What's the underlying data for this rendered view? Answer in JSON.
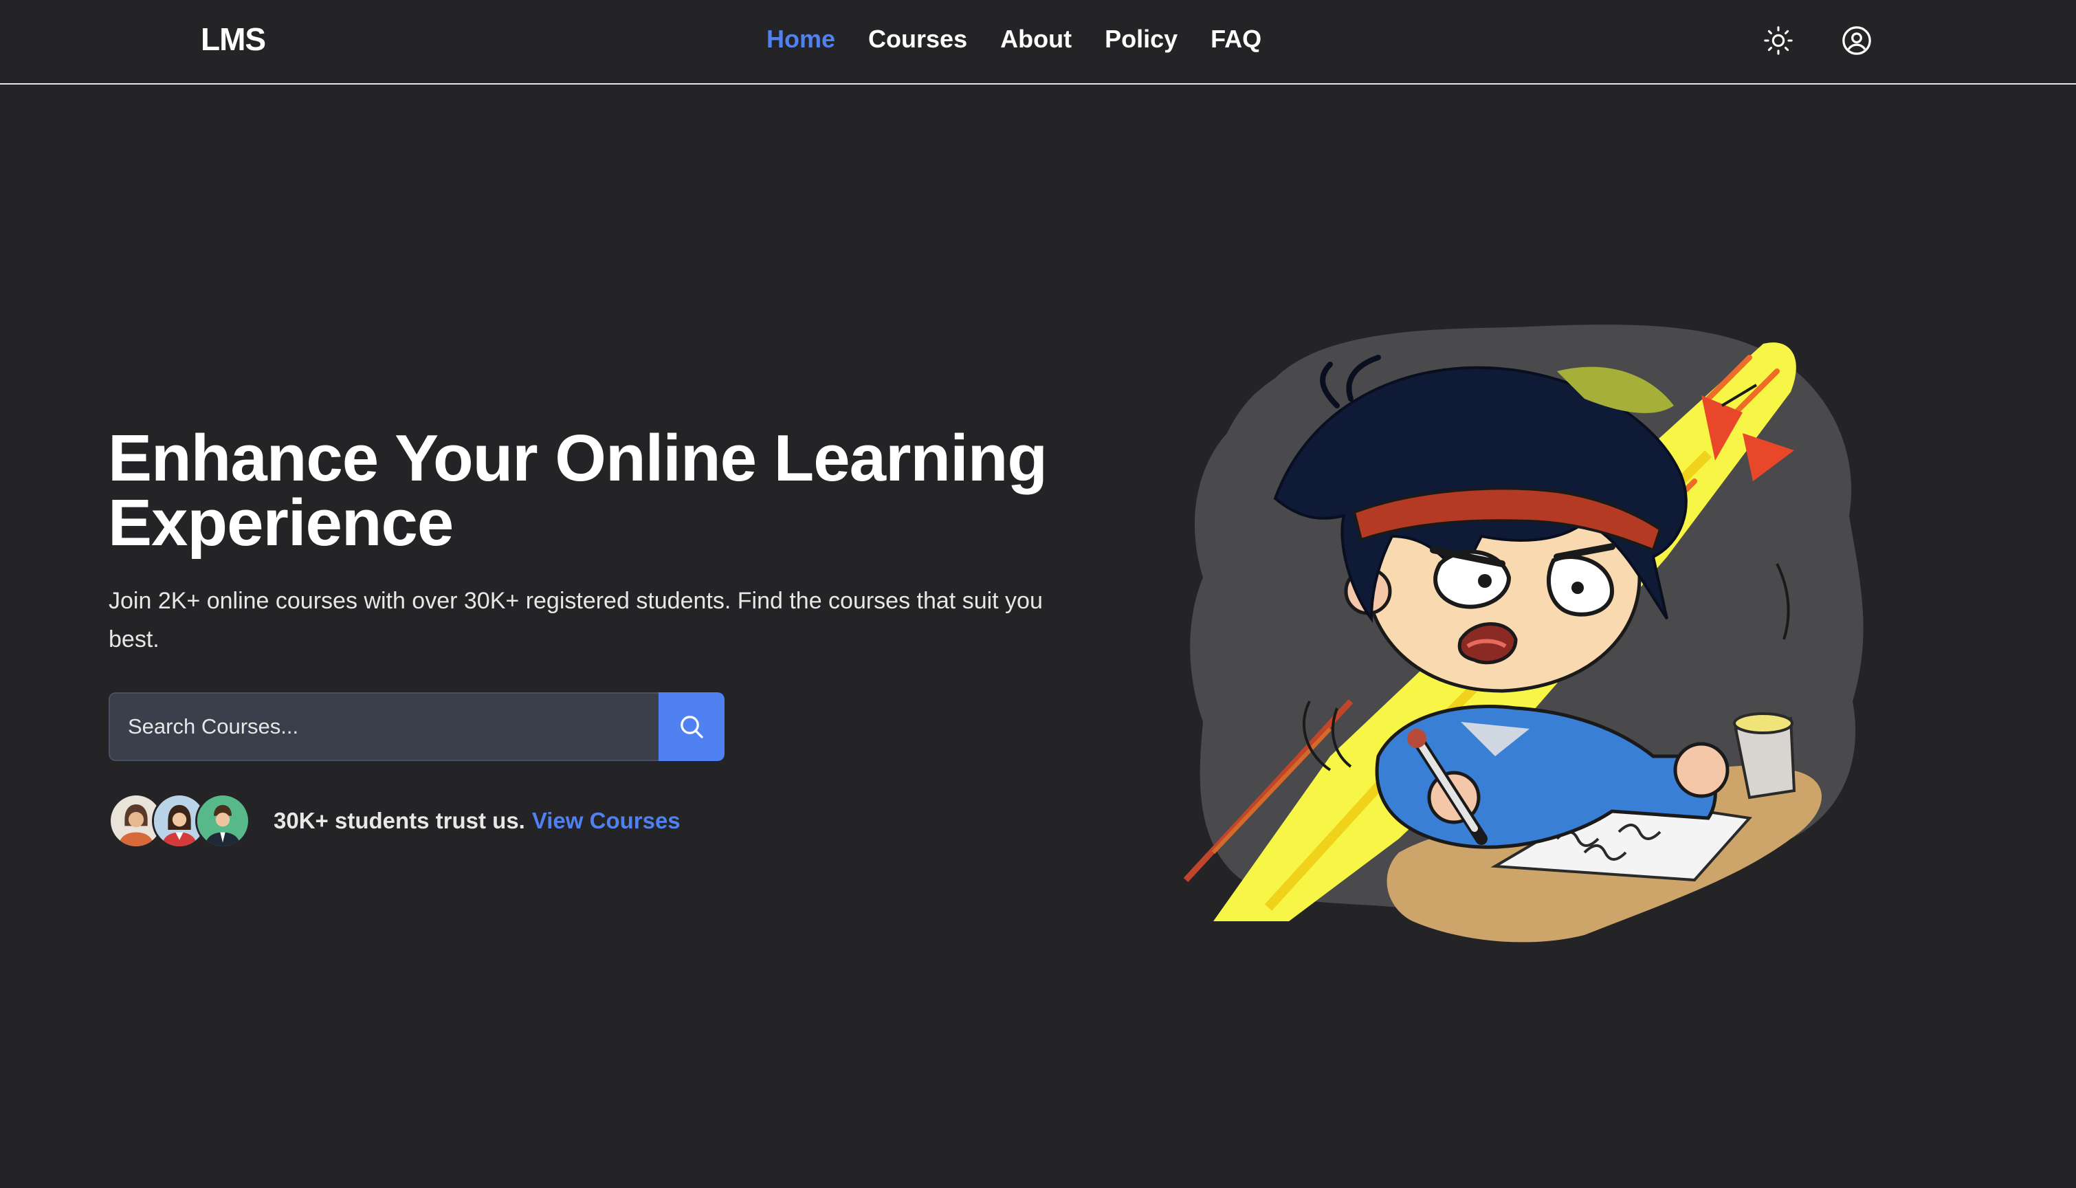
{
  "navbar": {
    "brand": "LMS",
    "links": [
      {
        "label": "Home",
        "active": true
      },
      {
        "label": "Courses",
        "active": false
      },
      {
        "label": "About",
        "active": false
      },
      {
        "label": "Policy",
        "active": false
      },
      {
        "label": "FAQ",
        "active": false
      }
    ],
    "icons": [
      "sun-icon",
      "user-circle-icon"
    ]
  },
  "hero": {
    "title": "Enhance Your Online Learning Experience",
    "subtitle": "Join 2K+ online courses with over 30K+ registered students. Find the courses that suit you best.",
    "search": {
      "placeholder": "Search Courses...",
      "value": "",
      "button_icon": "search-icon"
    },
    "trust": {
      "text": "30K+ students trust us.",
      "link": "View Courses"
    },
    "illustration_icon": "studying-anime-boy-illustration"
  },
  "colors": {
    "background": "#242426",
    "accent": "#4f81f0",
    "text": "#ffffff",
    "input_bg": "#3a3f4c"
  }
}
